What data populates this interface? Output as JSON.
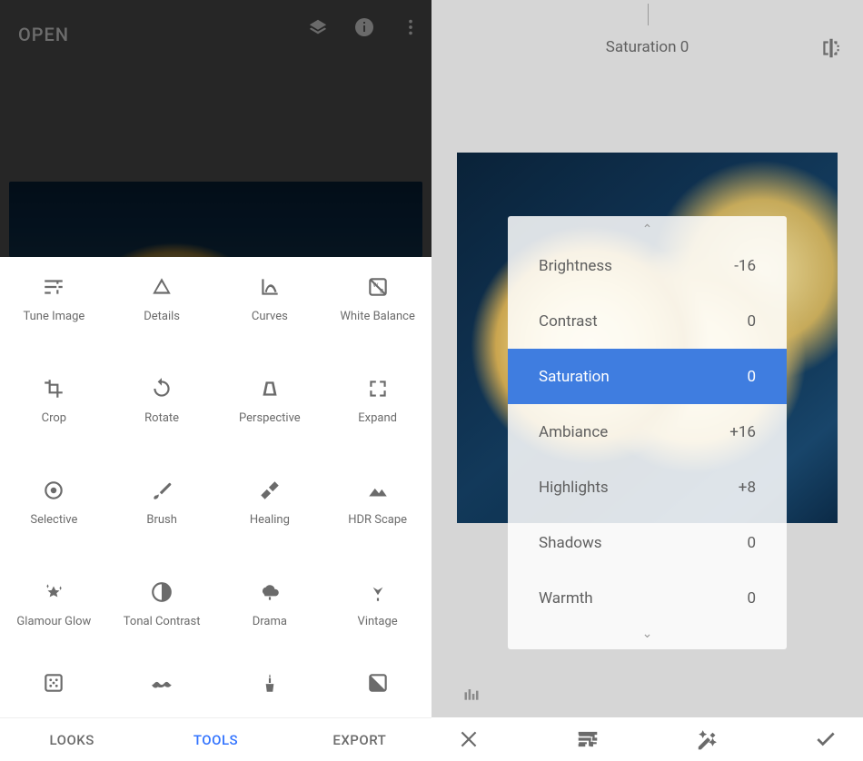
{
  "left": {
    "open_label": "OPEN",
    "tabs": {
      "looks": "LOOKS",
      "tools": "TOOLS",
      "export": "EXPORT",
      "active": "tools"
    },
    "tools": [
      {
        "label": "Tune Image"
      },
      {
        "label": "Details"
      },
      {
        "label": "Curves"
      },
      {
        "label": "White Balance"
      },
      {
        "label": "Crop"
      },
      {
        "label": "Rotate"
      },
      {
        "label": "Perspective"
      },
      {
        "label": "Expand"
      },
      {
        "label": "Selective"
      },
      {
        "label": "Brush"
      },
      {
        "label": "Healing"
      },
      {
        "label": "HDR Scape"
      },
      {
        "label": "Glamour Glow"
      },
      {
        "label": "Tonal Contrast"
      },
      {
        "label": "Drama"
      },
      {
        "label": "Vintage"
      }
    ]
  },
  "right": {
    "current_param_label": "Saturation 0",
    "params": [
      {
        "name": "Brightness",
        "value": "-16"
      },
      {
        "name": "Contrast",
        "value": "0"
      },
      {
        "name": "Saturation",
        "value": "0",
        "selected": true
      },
      {
        "name": "Ambiance",
        "value": "+16"
      },
      {
        "name": "Highlights",
        "value": "+8"
      },
      {
        "name": "Shadows",
        "value": "0"
      },
      {
        "name": "Warmth",
        "value": "0"
      }
    ]
  }
}
